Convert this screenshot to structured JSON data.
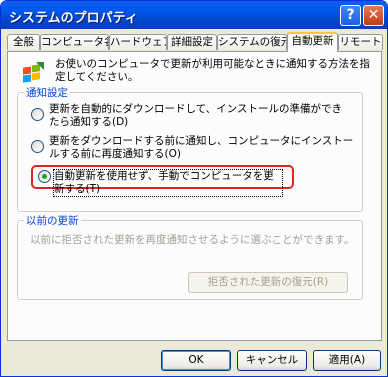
{
  "window": {
    "title": "システムのプロパティ",
    "help": "?",
    "close": "✕"
  },
  "tabs": [
    {
      "label": "全般"
    },
    {
      "label": "コンピュータ名"
    },
    {
      "label": "ハードウェア"
    },
    {
      "label": "詳細設定"
    },
    {
      "label": "システムの復元"
    },
    {
      "label": "自動更新",
      "active": true
    },
    {
      "label": "リモート"
    }
  ],
  "intro": {
    "icon": "windows-update-icon",
    "text": "お使いのコンピュータで更新が利用可能なときに通知する方法を指定してください。"
  },
  "notify_group": {
    "title": "通知設定",
    "options": [
      {
        "label": "更新を自動的にダウンロードして、インストールの準備ができたら通知する(D)",
        "selected": false
      },
      {
        "label": "更新をダウンロードする前に通知し、コンピュータにインストールする前に再度通知する(O)",
        "selected": false
      },
      {
        "label": "自動更新を使用せず、手動でコンピュータを更新する(T)",
        "selected": true
      }
    ]
  },
  "previous_group": {
    "title": "以前の更新",
    "text": "以前に拒否された更新を再度通知させるように選ぶことができます。",
    "restore_button": "拒否された更新の復元(R)"
  },
  "buttons": {
    "ok": "OK",
    "cancel": "キャンセル",
    "apply": "適用(A)"
  },
  "colors": {
    "titlebar": "#0058ee",
    "highlight": "#e0241f",
    "radio_dot": "#21a121"
  }
}
